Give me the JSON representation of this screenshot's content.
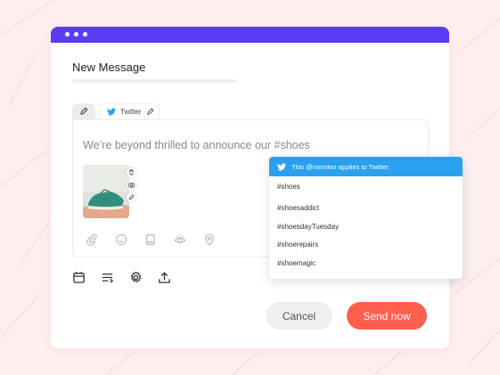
{
  "composer": {
    "title": "New Message",
    "tabs": [
      {
        "label": "",
        "icon": "pencil-icon"
      },
      {
        "label": "Twitter",
        "icon": "twitter-icon"
      }
    ],
    "message_text": "We’re beyond thrilled to announce our #shoes",
    "attachment_actions": [
      "trash-icon",
      "camera-icon",
      "pencil-icon"
    ],
    "tools": [
      "paperclip-icon",
      "emoji-icon",
      "book-icon",
      "eye-icon",
      "location-pin-icon"
    ]
  },
  "bottom_toolbar": [
    "calendar-icon",
    "queue-icon",
    "gear-icon",
    "upload-icon"
  ],
  "actions": {
    "cancel_label": "Cancel",
    "send_label": "Send now"
  },
  "suggestions": {
    "header": "This @mention applies to Twitter.",
    "items": [
      "#shoes",
      "#shoesaddict",
      "#shoesdayTuesday",
      "#shoerepairs",
      "#shoemagic"
    ]
  },
  "colors": {
    "background": "#fcefee",
    "titlebar": "#5a3cf2",
    "send_button": "#ff5f4e",
    "twitter_blue": "#2aa1ef"
  }
}
